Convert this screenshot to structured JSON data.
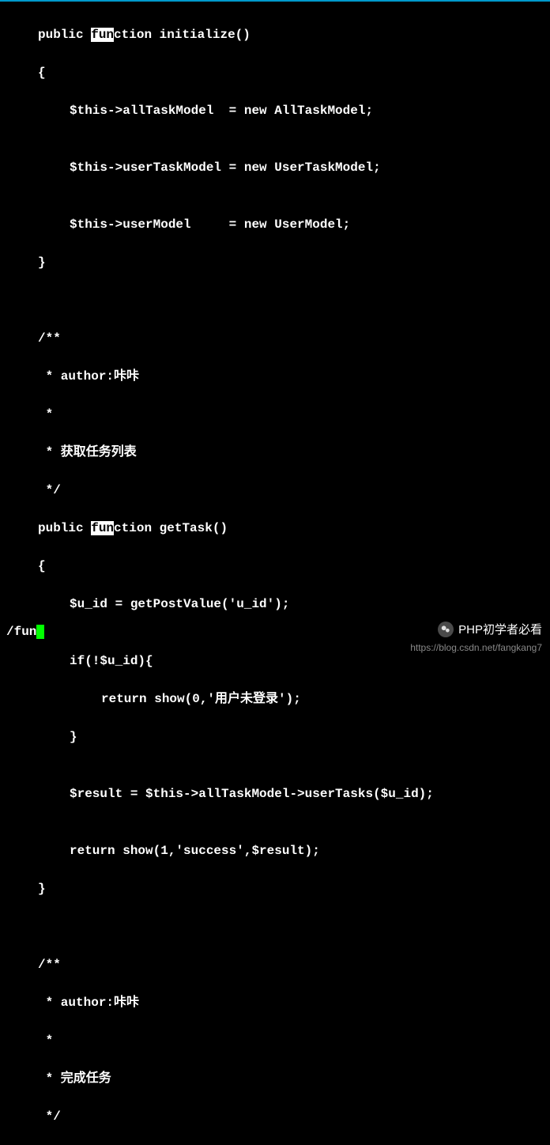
{
  "code": {
    "fn_keyword_highlighted": "fun",
    "fn_keyword_rest": "ction",
    "line1": {
      "prefix": "public ",
      "method": " initialize()"
    },
    "line2": "{",
    "line3": "$this->allTaskModel  = new AllTaskModel;",
    "line4": "",
    "line5": "$this->userTaskModel = new UserTaskModel;",
    "line6": "",
    "line7": "$this->userModel     = new UserModel;",
    "line8": "}",
    "line9": "",
    "line10": "",
    "line11": "/**",
    "line12": " * author:咔咔",
    "line13": " *",
    "line14": " * 获取任务列表",
    "line15": " */",
    "line16": {
      "prefix": "public ",
      "method": " getTask()"
    },
    "line17": "{",
    "line18": "$u_id = getPostValue('u_id');",
    "line19": "",
    "line20": "if(!$u_id){",
    "line21": "return show(0,'用户未登录');",
    "line22": "}",
    "line23": "",
    "line24": "$result = $this->allTaskModel->userTasks($u_id);",
    "line25": "",
    "line26": "return show(1,'success',$result);",
    "line27": "}",
    "line28": "",
    "line29": "",
    "line30": "/**",
    "line31": " * author:咔咔",
    "line32": " *",
    "line33": " * 完成任务",
    "line34": " */"
  },
  "status": "/fun",
  "watermark": {
    "text": "PHP初学者必看",
    "url": "https://blog.csdn.net/fangkang7"
  }
}
